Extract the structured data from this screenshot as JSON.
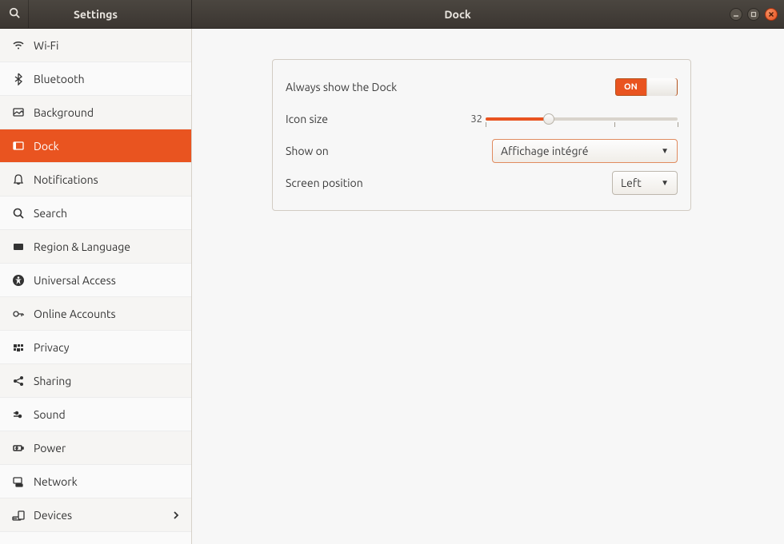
{
  "titlebar": {
    "left_title": "Settings",
    "right_title": "Dock"
  },
  "sidebar": {
    "items": [
      {
        "label": "Wi-Fi"
      },
      {
        "label": "Bluetooth"
      },
      {
        "label": "Background"
      },
      {
        "label": "Dock"
      },
      {
        "label": "Notifications"
      },
      {
        "label": "Search"
      },
      {
        "label": "Region & Language"
      },
      {
        "label": "Universal Access"
      },
      {
        "label": "Online Accounts"
      },
      {
        "label": "Privacy"
      },
      {
        "label": "Sharing"
      },
      {
        "label": "Sound"
      },
      {
        "label": "Power"
      },
      {
        "label": "Network"
      },
      {
        "label": "Devices"
      }
    ]
  },
  "dock_panel": {
    "always_show_label": "Always show the Dock",
    "always_show_state": "ON",
    "icon_size_label": "Icon size",
    "icon_size_value": "32",
    "show_on_label": "Show on",
    "show_on_value": "Affichage intégré",
    "screen_pos_label": "Screen position",
    "screen_pos_value": "Left"
  }
}
